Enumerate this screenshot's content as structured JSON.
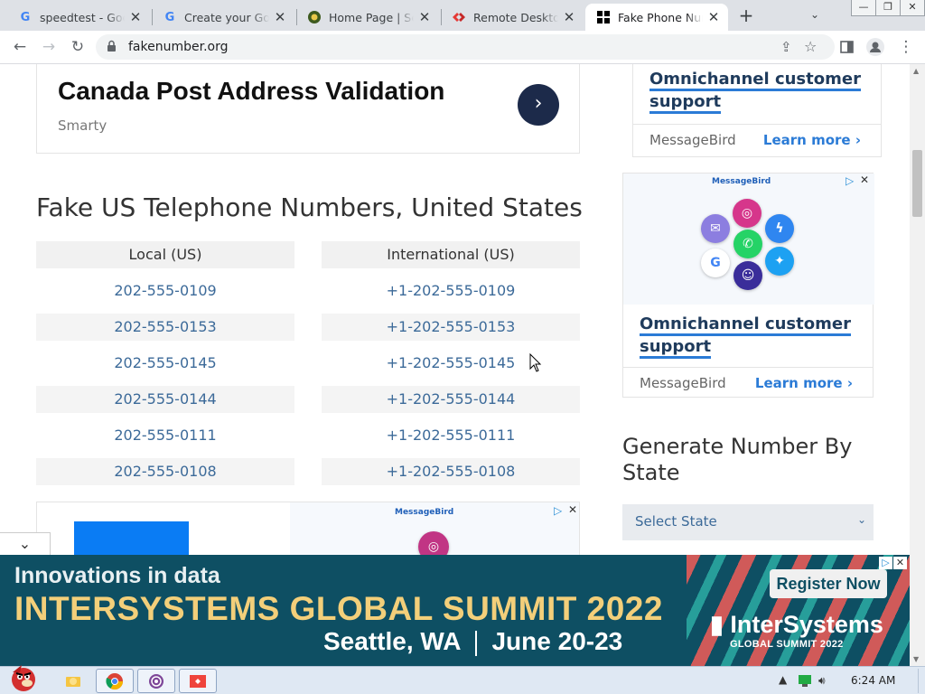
{
  "browser": {
    "tabs": [
      {
        "title": "speedtest - Google Search",
        "favicon": "google-icon",
        "active": false
      },
      {
        "title": "Create your Google Account",
        "favicon": "google-icon",
        "active": false
      },
      {
        "title": "Home Page | Sec",
        "favicon": "site-icon",
        "active": false
      },
      {
        "title": "Remote Desktop",
        "favicon": "remote-desktop-icon",
        "active": false
      },
      {
        "title": "Fake Phone Numbers",
        "favicon": "grid-icon",
        "active": true
      }
    ],
    "url": "fakenumber.org"
  },
  "ad_top": {
    "headline": "Canada Post Address Validation",
    "brand": "Smarty"
  },
  "section_title": "Fake US Telephone Numbers, United States",
  "table": {
    "headers": [
      "Local (US)",
      "International (US)"
    ],
    "local": [
      "202-555-0109",
      "202-555-0153",
      "202-555-0145",
      "202-555-0144",
      "202-555-0111",
      "202-555-0108"
    ],
    "international": [
      "+1-202-555-0109",
      "+1-202-555-0153",
      "+1-202-555-0145",
      "+1-202-555-0144",
      "+1-202-555-0111",
      "+1-202-555-0108"
    ]
  },
  "ad_bottom": {
    "brand": "MessageBird"
  },
  "sidebar": {
    "card1": {
      "title": "Omnichannel customer support",
      "advertiser": "MessageBird",
      "cta": "Learn more"
    },
    "card2": {
      "brand": "MessageBird",
      "title": "Omnichannel customer support",
      "advertiser": "MessageBird",
      "cta": "Learn more"
    },
    "generate_title": "Generate Number By State",
    "select_value": "Select State"
  },
  "banner": {
    "line1": "Innovations in data",
    "line2": "INTERSYSTEMS GLOBAL SUMMIT 2022",
    "location": "Seattle, WA",
    "dates": "June 20-23",
    "cta": "Register Now",
    "logo": "InterSystems",
    "logo_sub": "GLOBAL SUMMIT 2022"
  },
  "taskbar": {
    "time": "6:24 AM"
  },
  "colors": {
    "link": "#3c6a99",
    "accent": "#2b7bd6",
    "banner_bg": "#0e4f63",
    "banner_gold": "#f3cf7a"
  }
}
